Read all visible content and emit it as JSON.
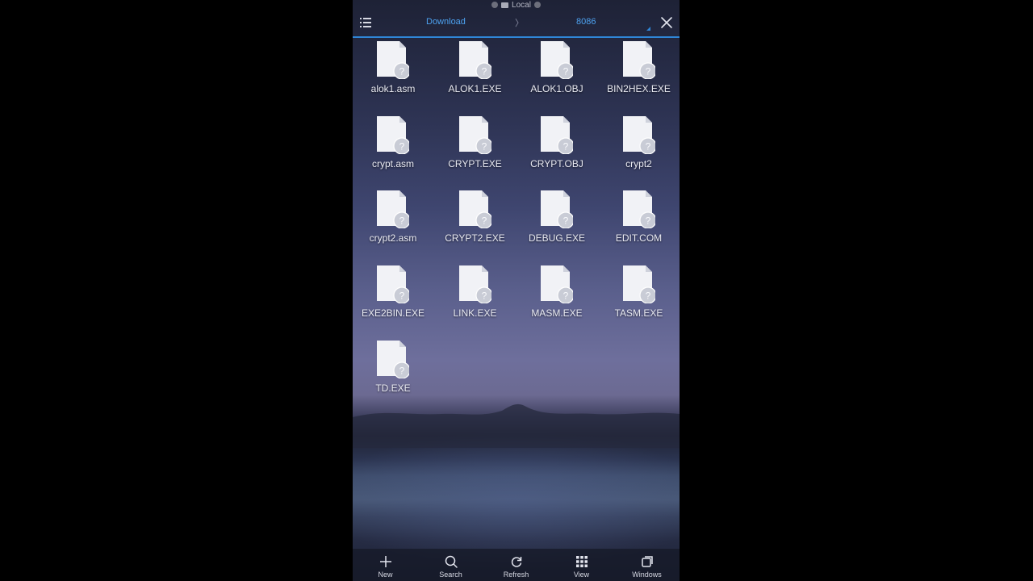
{
  "status_bar": {
    "label": "Local"
  },
  "toolbar": {
    "breadcrumb": [
      "Download",
      "8086"
    ],
    "separator": "〉"
  },
  "files": [
    {
      "name": "alok1.asm",
      "icon": "unknown-file-icon"
    },
    {
      "name": "ALOK1.EXE",
      "icon": "unknown-file-icon"
    },
    {
      "name": "ALOK1.OBJ",
      "icon": "unknown-file-icon"
    },
    {
      "name": "BIN2HEX.EXE",
      "icon": "unknown-file-icon"
    },
    {
      "name": "crypt.asm",
      "icon": "unknown-file-icon"
    },
    {
      "name": "CRYPT.EXE",
      "icon": "unknown-file-icon"
    },
    {
      "name": "CRYPT.OBJ",
      "icon": "unknown-file-icon"
    },
    {
      "name": "crypt2",
      "icon": "unknown-file-icon"
    },
    {
      "name": "crypt2.asm",
      "icon": "unknown-file-icon"
    },
    {
      "name": "CRYPT2.EXE",
      "icon": "unknown-file-icon"
    },
    {
      "name": "DEBUG.EXE",
      "icon": "unknown-file-icon"
    },
    {
      "name": "EDIT.COM",
      "icon": "unknown-file-icon"
    },
    {
      "name": "EXE2BIN.EXE",
      "icon": "unknown-file-icon"
    },
    {
      "name": "LINK.EXE",
      "icon": "unknown-file-icon"
    },
    {
      "name": "MASM.EXE",
      "icon": "unknown-file-icon"
    },
    {
      "name": "TASM.EXE",
      "icon": "unknown-file-icon"
    },
    {
      "name": "TD.EXE",
      "icon": "unknown-file-icon"
    }
  ],
  "bottom_bar": [
    {
      "label": "New",
      "icon": "plus-icon"
    },
    {
      "label": "Search",
      "icon": "search-icon"
    },
    {
      "label": "Refresh",
      "icon": "refresh-icon"
    },
    {
      "label": "View",
      "icon": "grid-icon"
    },
    {
      "label": "Windows",
      "icon": "windows-icon"
    }
  ],
  "colors": {
    "accent": "#2f86d8",
    "breadcrumb_text": "#4da2f0"
  }
}
